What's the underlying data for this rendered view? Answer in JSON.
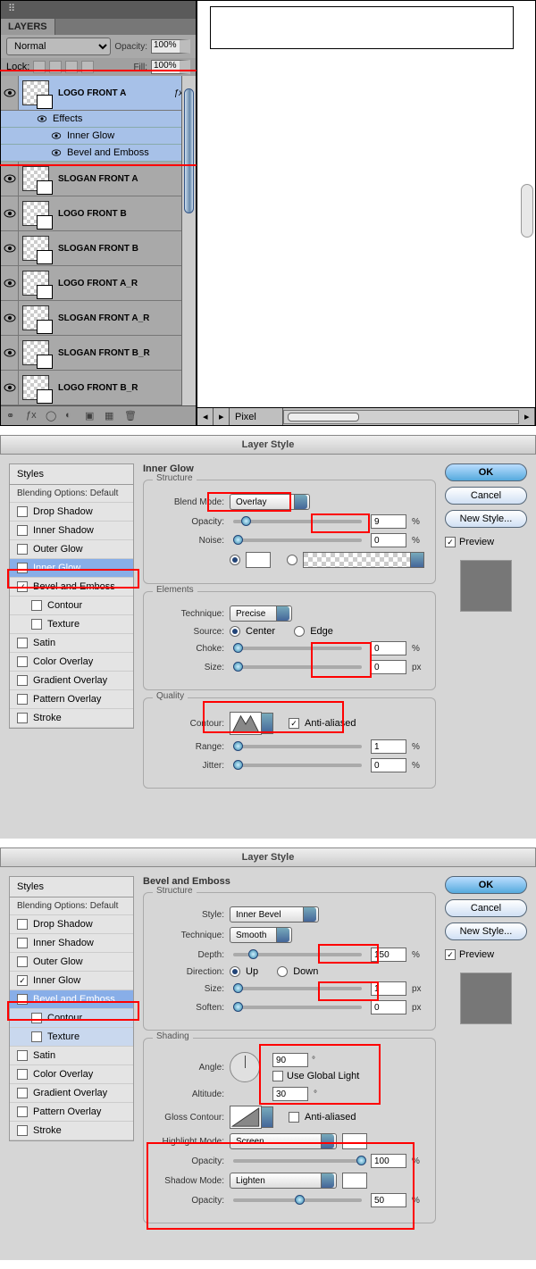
{
  "layers_panel": {
    "title": "LAYERS",
    "blend_mode": "Normal",
    "opacity_label": "Opacity:",
    "opacity_value": "100%",
    "lock_label": "Lock:",
    "fill_label": "Fill:",
    "fill_value": "100%",
    "layers": [
      {
        "name": "LOGO FRONT A",
        "selected": true,
        "fx": true
      },
      {
        "name": "SLOGAN FRONT A"
      },
      {
        "name": "LOGO FRONT B"
      },
      {
        "name": "SLOGAN FRONT B"
      },
      {
        "name": "LOGO FRONT A_R"
      },
      {
        "name": "SLOGAN FRONT A_R"
      },
      {
        "name": "SLOGAN FRONT B_R"
      },
      {
        "name": "LOGO FRONT B_R"
      }
    ],
    "effects_label": "Effects",
    "effect_items": [
      "Inner Glow",
      "Bevel and Emboss"
    ]
  },
  "canvas": {
    "unit": "Pixel"
  },
  "dlg_title": "Layer Style",
  "styles_sidebar": {
    "header": "Styles",
    "blending": "Blending Options: Default",
    "items": [
      "Drop Shadow",
      "Inner Shadow",
      "Outer Glow",
      "Inner Glow",
      "Bevel and Emboss",
      "Contour",
      "Texture",
      "Satin",
      "Color Overlay",
      "Gradient Overlay",
      "Pattern Overlay",
      "Stroke"
    ]
  },
  "inner_glow": {
    "title": "Inner Glow",
    "structure": "Structure",
    "blend_mode_label": "Blend Mode:",
    "blend_mode": "Overlay",
    "opacity_label": "Opacity:",
    "opacity": "9",
    "noise_label": "Noise:",
    "noise": "0",
    "elements": "Elements",
    "technique_label": "Technique:",
    "technique": "Precise",
    "source_label": "Source:",
    "center": "Center",
    "edge": "Edge",
    "choke_label": "Choke:",
    "choke": "0",
    "size_label": "Size:",
    "size": "0",
    "quality": "Quality",
    "contour_label": "Contour:",
    "antialiased": "Anti-aliased",
    "range_label": "Range:",
    "range": "1",
    "jitter_label": "Jitter:",
    "jitter": "0"
  },
  "bevel": {
    "title": "Bevel and Emboss",
    "structure": "Structure",
    "style_label": "Style:",
    "style": "Inner Bevel",
    "technique_label": "Technique:",
    "technique": "Smooth",
    "depth_label": "Depth:",
    "depth": "150",
    "direction_label": "Direction:",
    "up": "Up",
    "down": "Down",
    "size_label": "Size:",
    "size": "1",
    "soften_label": "Soften:",
    "soften": "0",
    "shading": "Shading",
    "angle_label": "Angle:",
    "angle": "90",
    "globallight": "Use Global Light",
    "altitude_label": "Altitude:",
    "altitude": "30",
    "gloss_label": "Gloss Contour:",
    "antialiased": "Anti-aliased",
    "hmode_label": "Highlight Mode:",
    "hmode": "Screen",
    "hopacity_label": "Opacity:",
    "hopacity": "100",
    "smode_label": "Shadow Mode:",
    "smode": "Lighten",
    "sopacity_label": "Opacity:",
    "sopacity": "50"
  },
  "buttons": {
    "ok": "OK",
    "cancel": "Cancel",
    "newstyle": "New Style...",
    "preview": "Preview"
  },
  "pct": "%",
  "px": "px",
  "deg": "°"
}
